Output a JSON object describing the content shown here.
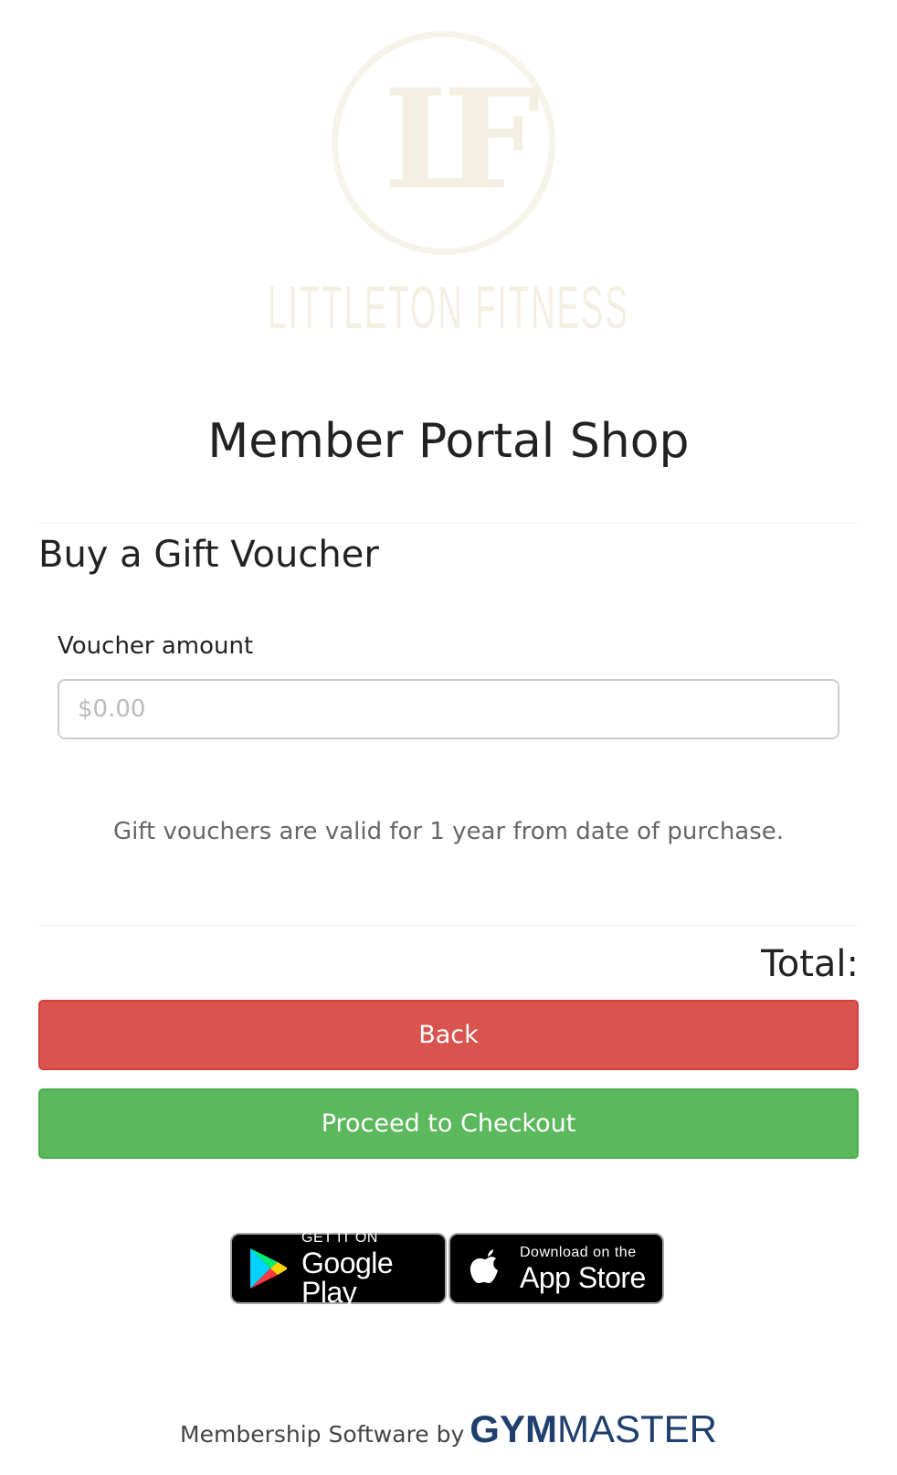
{
  "brand": {
    "logo_monogram": "LF",
    "logo_wordmark": "LITTLETON FITNESS"
  },
  "page": {
    "title": "Member Portal Shop"
  },
  "voucher": {
    "section_title": "Buy a Gift Voucher",
    "amount_label": "Voucher amount",
    "amount_placeholder": "$0.00",
    "amount_value": "",
    "validity_note": "Gift vouchers are valid for 1 year from date of purchase."
  },
  "summary": {
    "total_label": "Total:"
  },
  "actions": {
    "back_label": "Back",
    "checkout_label": "Proceed to Checkout"
  },
  "stores": {
    "google_small": "GET IT ON",
    "google_big": "Google Play",
    "apple_small": "Download on the",
    "apple_big": "App Store"
  },
  "footer": {
    "prefix": "Membership Software by",
    "brand_gym": "GYM",
    "brand_master": "MASTER"
  },
  "colors": {
    "back_button": "#d9534f",
    "checkout_button": "#5cb85c",
    "brand_blue": "#1f3f6e",
    "logo_tint": "#f3efe3"
  }
}
